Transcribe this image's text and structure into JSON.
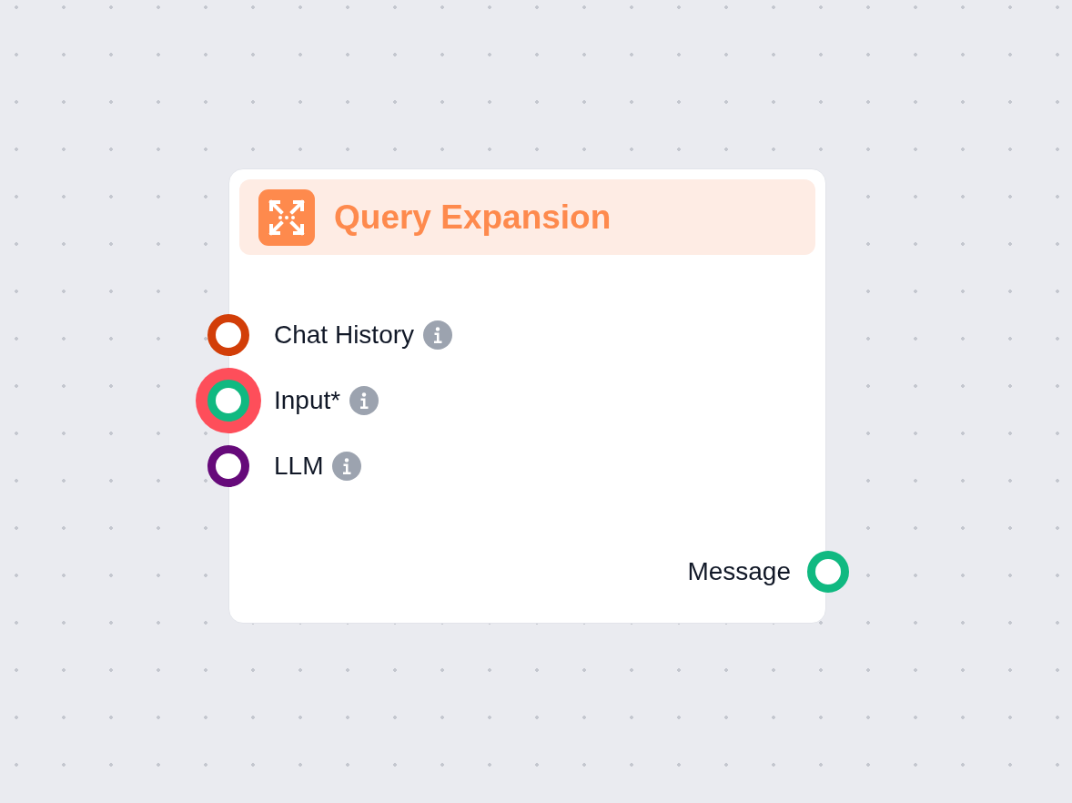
{
  "node": {
    "title": "Query Expansion",
    "inputs": [
      {
        "label": "Chat History",
        "color": "#d23e08",
        "highlighted": false
      },
      {
        "label": "Input*",
        "color": "#10b981",
        "highlighted": true
      },
      {
        "label": "LLM",
        "color": "#660a7a",
        "highlighted": false
      }
    ],
    "outputs": [
      {
        "label": "Message",
        "color": "#10b981",
        "highlighted": false
      }
    ]
  }
}
